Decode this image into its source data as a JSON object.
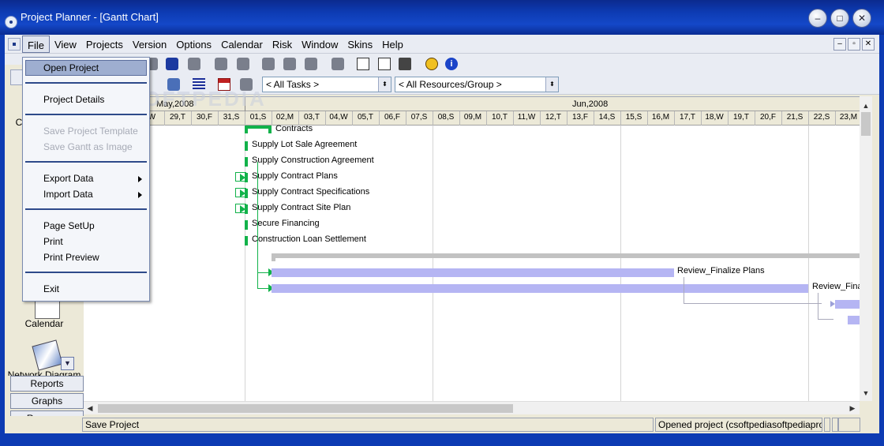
{
  "window": {
    "title": "Project Planner - [Gantt Chart]",
    "min": "–",
    "max": "□",
    "close": "✕"
  },
  "menubar": {
    "items": [
      "File",
      "View",
      "Projects",
      "Version",
      "Options",
      "Calendar",
      "Risk",
      "Window",
      "Skins",
      "Help"
    ],
    "active": "File",
    "mdi_min": "–",
    "mdi_max": "▫",
    "mdi_close": "✕"
  },
  "toolbar": {
    "tasks_filter": "< All Tasks >",
    "resources_filter": "< All Resources/Group >",
    "combo_arrow": "⬍",
    "info": "i"
  },
  "file_menu": {
    "open_project": "Open Project",
    "project_details": "Project Details",
    "save_template": "Save Project Template",
    "save_gantt_image": "Save Gantt as Image",
    "export_data": "Export Data",
    "import_data": "Import Data",
    "page_setup": "Page SetUp",
    "print": "Print",
    "print_preview": "Print Preview",
    "exit": "Exit"
  },
  "left_pane": {
    "partial_label": "C",
    "calendar": "Calendar",
    "network": "Network Diagram",
    "expand": "▼",
    "buttons": [
      "Reports",
      "Graphs",
      "Resource"
    ]
  },
  "timeline": {
    "months": [
      "May,2008",
      "Jun,2008"
    ],
    "days": [
      ",W",
      "29,T",
      "30,F",
      "31,S",
      "01,S",
      "02,M",
      "03,T",
      "04,W",
      "05,T",
      "06,F",
      "07,S",
      "08,S",
      "09,M",
      "10,T",
      "11,W",
      "12,T",
      "13,F",
      "14,S",
      "15,S",
      "16,M",
      "17,T",
      "18,W",
      "19,T",
      "20,F",
      "21,S",
      "22,S",
      "23,M"
    ]
  },
  "tasks": {
    "contracts": "Contracts",
    "t1": "Supply Lot Sale Agreement",
    "t2": "Supply Construction Agreement",
    "t3": "Supply Contract Plans",
    "t4": "Supply Contract Specifications",
    "t5": "Supply Contract Site Plan",
    "t6": "Secure Financing",
    "t7": "Construction Loan Settlement",
    "r1": "Review_Finalize Plans",
    "r2": "Review_Fina"
  },
  "scroll": {
    "up": "▲",
    "down": "▼",
    "left": "◀",
    "right": "▶"
  },
  "status": {
    "left": "Save Project",
    "right": "Opened project (csoftpediasoftpediaproject."
  },
  "watermark": "SOFTPEDIA",
  "colors": {
    "title_blue": "#0d3bb3",
    "milestone_green": "#12b24a",
    "bar_blue": "#b5b5f3",
    "summary_gray": "#c2c2c2"
  }
}
